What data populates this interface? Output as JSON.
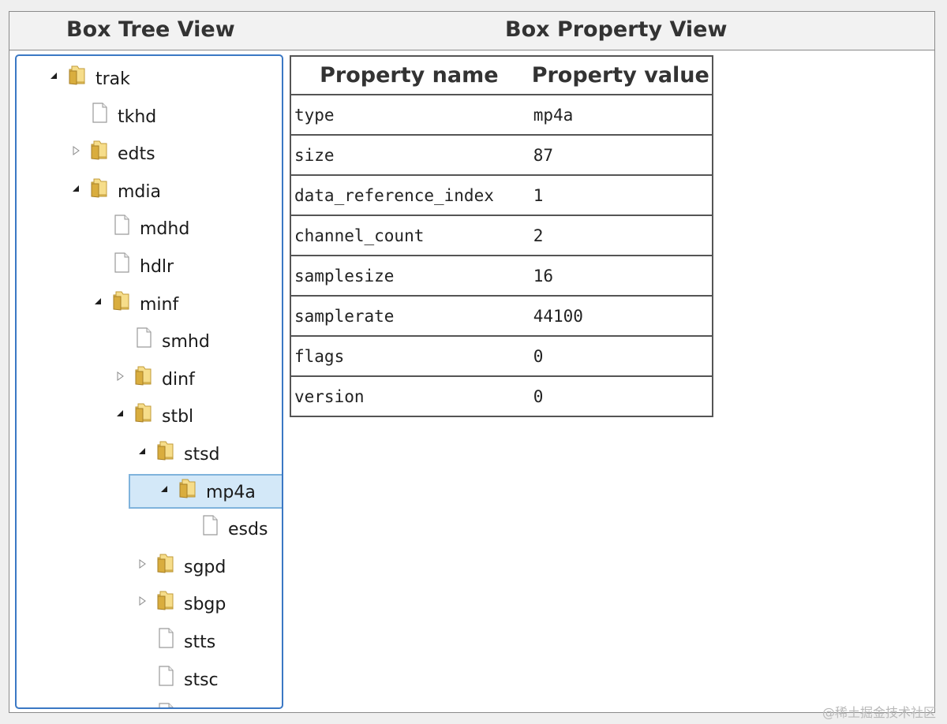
{
  "headers": {
    "tree_title": "Box Tree View",
    "property_title": "Box Property View"
  },
  "tree": {
    "nodes": [
      {
        "label": "trak",
        "depth": 0,
        "kind": "folder",
        "expander": "expanded",
        "selected": false
      },
      {
        "label": "tkhd",
        "depth": 1,
        "kind": "file",
        "expander": "none",
        "selected": false
      },
      {
        "label": "edts",
        "depth": 1,
        "kind": "folder",
        "expander": "collapsed",
        "selected": false
      },
      {
        "label": "mdia",
        "depth": 1,
        "kind": "folder",
        "expander": "expanded",
        "selected": false
      },
      {
        "label": "mdhd",
        "depth": 2,
        "kind": "file",
        "expander": "none",
        "selected": false
      },
      {
        "label": "hdlr",
        "depth": 2,
        "kind": "file",
        "expander": "none",
        "selected": false
      },
      {
        "label": "minf",
        "depth": 2,
        "kind": "folder",
        "expander": "expanded",
        "selected": false
      },
      {
        "label": "smhd",
        "depth": 3,
        "kind": "file",
        "expander": "none",
        "selected": false
      },
      {
        "label": "dinf",
        "depth": 3,
        "kind": "folder",
        "expander": "collapsed",
        "selected": false
      },
      {
        "label": "stbl",
        "depth": 3,
        "kind": "folder",
        "expander": "expanded",
        "selected": false
      },
      {
        "label": "stsd",
        "depth": 4,
        "kind": "folder",
        "expander": "expanded",
        "selected": false
      },
      {
        "label": "mp4a",
        "depth": 5,
        "kind": "folder",
        "expander": "expanded",
        "selected": true
      },
      {
        "label": "esds",
        "depth": 6,
        "kind": "file",
        "expander": "none",
        "selected": false
      },
      {
        "label": "sgpd",
        "depth": 4,
        "kind": "folder",
        "expander": "collapsed",
        "selected": false
      },
      {
        "label": "sbgp",
        "depth": 4,
        "kind": "folder",
        "expander": "collapsed",
        "selected": false
      },
      {
        "label": "stts",
        "depth": 4,
        "kind": "file",
        "expander": "none",
        "selected": false
      },
      {
        "label": "stsc",
        "depth": 4,
        "kind": "file",
        "expander": "none",
        "selected": false
      },
      {
        "label": "",
        "depth": 4,
        "kind": "file",
        "expander": "none",
        "selected": false
      }
    ]
  },
  "properties": {
    "columns": {
      "name": "Property name",
      "value": "Property value"
    },
    "rows": [
      {
        "name": "type",
        "value": "mp4a"
      },
      {
        "name": "size",
        "value": "87"
      },
      {
        "name": "data_reference_index",
        "value": "1"
      },
      {
        "name": "channel_count",
        "value": "2"
      },
      {
        "name": "samplesize",
        "value": "16"
      },
      {
        "name": "samplerate",
        "value": "44100"
      },
      {
        "name": "flags",
        "value": "0"
      },
      {
        "name": "version",
        "value": "0"
      }
    ]
  },
  "watermark": "@稀土掘金技术社区",
  "colors": {
    "selection_bg": "#d3e8f8",
    "selection_border": "#7fb3dc",
    "tree_border": "#3b78c4",
    "folder": "#e8c35a"
  }
}
